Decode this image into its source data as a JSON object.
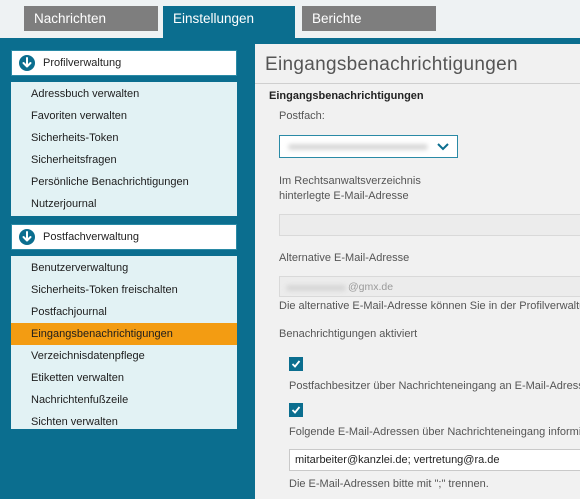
{
  "tabs": [
    {
      "label": "Nachrichten",
      "active": false
    },
    {
      "label": "Einstellungen",
      "active": true
    },
    {
      "label": "Berichte",
      "active": false
    }
  ],
  "sidebar": {
    "sections": [
      {
        "title": "Profilverwaltung",
        "icon": "arrow-down-circle-icon",
        "items": [
          "Adressbuch verwalten",
          "Favoriten verwalten",
          "Sicherheits-Token",
          "Sicherheitsfragen",
          "Persönliche Benachrichtigungen",
          "Nutzerjournal"
        ]
      },
      {
        "title": "Postfachverwaltung",
        "icon": "arrow-down-circle-icon",
        "items": [
          "Benutzerverwaltung",
          "Sicherheits-Token freischalten",
          "Postfachjournal",
          "Eingangsbenachrichtigungen",
          "Verzeichnisdatenpflege",
          "Etiketten verwalten",
          "Nachrichtenfußzeile",
          "Sichten verwalten"
        ],
        "selected_item": "Eingangsbenachrichtigungen"
      }
    ]
  },
  "main": {
    "title": "Eingangsbenachrichtigungen",
    "subtitle": "Eingangsbenachrichtigungen",
    "postfach_label": "Postfach:",
    "rechtsanwalt_label_line1": "Im Rechtsanwaltsverzeichnis",
    "rechtsanwalt_label_line2": "hinterlegte E-Mail-Adresse",
    "alt_email_label": "Alternative E-Mail-Adresse",
    "alt_email_value_suffix": "@gmx.de",
    "alt_email_hint": "Die alternative E-Mail-Adresse können Sie in der Profilverwaltung",
    "notifications_label": "Benachrichtigungen aktiviert",
    "checkbox1_label": "Postfachbesitzer über Nachrichteneingang an E-Mail-Adresse",
    "checkbox1_checked": true,
    "checkbox2_label": "Folgende E-Mail-Adressen über Nachrichteneingang informieren",
    "checkbox2_checked": true,
    "email_list_value": "mitarbeiter@kanzlei.de; vertretung@ra.de",
    "email_list_hint": "Die E-Mail-Adressen bitte mit \";\" trennen."
  },
  "colors": {
    "primary": "#0b6e8f",
    "selected": "#f39c12",
    "sidebar_bg": "#e2f2f4"
  }
}
